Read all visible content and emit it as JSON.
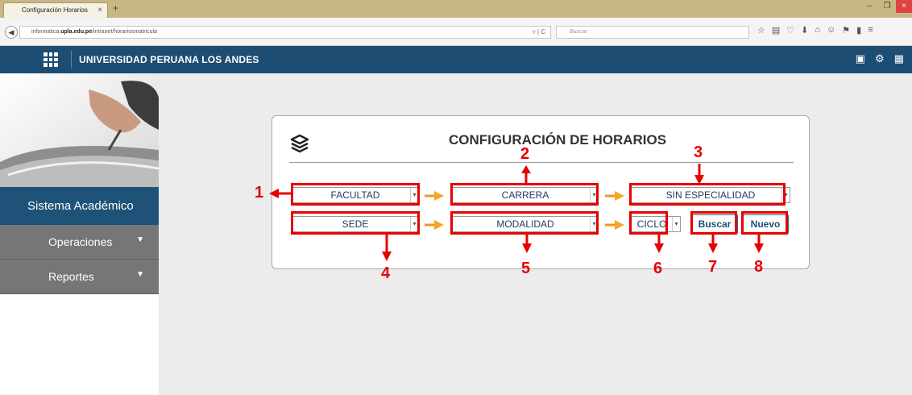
{
  "browser": {
    "tab_title": "Configuración Horarios",
    "tab_close": "×",
    "new_tab": "+",
    "url_prefix": "informatica.",
    "url_domain": "upla.edu.pe",
    "url_path": "/intranet/horariosmatricula",
    "search_placeholder": "Buscar",
    "win_min": "–",
    "win_max": "❐",
    "win_close": "×"
  },
  "header": {
    "university": "UNIVERSIDAD PERUANA LOS ANDES"
  },
  "sidebar": {
    "system": "Sistema Académico",
    "items": [
      {
        "label": "Operaciones"
      },
      {
        "label": "Reportes"
      }
    ]
  },
  "card": {
    "title": "CONFIGURACIÓN DE HORARIOS",
    "facultad": "FACULTAD",
    "carrera": "CARRERA",
    "especialidad": "SIN ESPECIALIDAD",
    "sede": "SEDE",
    "modalidad": "MODALIDAD",
    "ciclo": "CICLO",
    "buscar": "Buscar",
    "nuevo": "Nuevo"
  },
  "annotations": [
    "1",
    "2",
    "3",
    "4",
    "5",
    "6",
    "7",
    "8"
  ],
  "colors": {
    "header": "#1e4d73",
    "sidebar_active": "#1e5278",
    "sidebar_item": "#767676",
    "annotation": "#e60000"
  }
}
